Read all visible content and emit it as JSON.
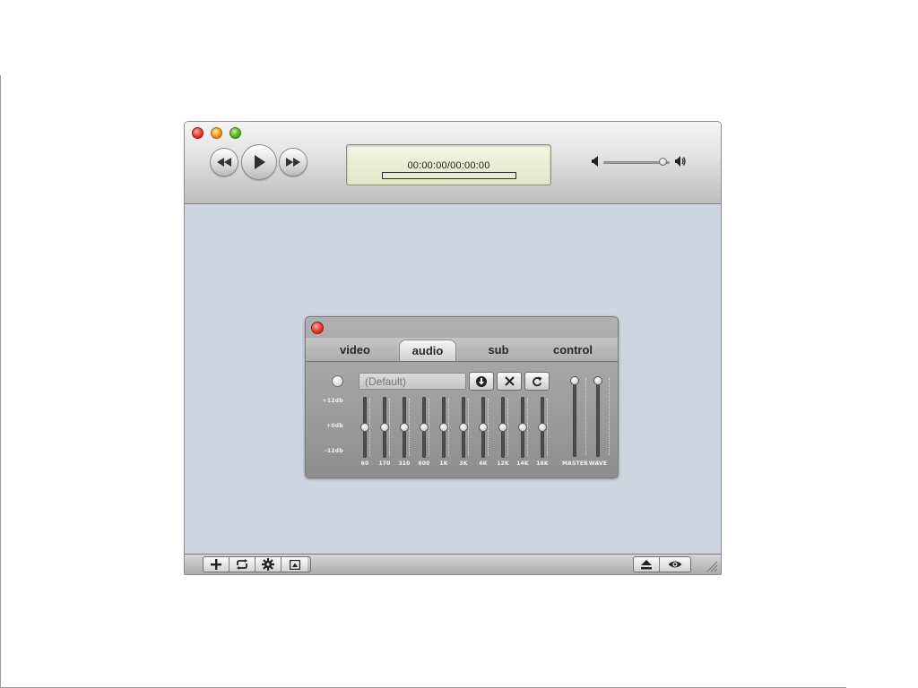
{
  "player": {
    "time_display": "00:00:00/00:00:00",
    "progress": 0,
    "volume": 0.95
  },
  "icons": {
    "window": [
      "close-icon",
      "minimize-icon",
      "zoom-icon"
    ],
    "transport": [
      "rewind-icon",
      "play-icon",
      "fast-forward-icon"
    ],
    "volume": [
      "speaker-low-icon",
      "speaker-high-icon"
    ],
    "bottom_left": [
      "add-icon",
      "repeat-icon",
      "gear-icon",
      "display-icon"
    ],
    "bottom_right": [
      "eject-icon",
      "eye-icon"
    ]
  },
  "colors": {
    "content_background": "#cfd5e0",
    "lcd_background": "#e8ebd0",
    "close_red": "#e84a3c",
    "minimize_yellow": "#f3a72a",
    "zoom_green": "#5fbd32"
  },
  "equalizer": {
    "tabs": [
      "video",
      "audio",
      "sub",
      "control"
    ],
    "active_tab": "audio",
    "preset_placeholder": "(Default)",
    "preset_value": "",
    "db_labels": [
      "+12db",
      "+0db",
      "-12db"
    ],
    "bands": [
      {
        "label": "60",
        "gain_db": 0
      },
      {
        "label": "170",
        "gain_db": 0
      },
      {
        "label": "310",
        "gain_db": 0
      },
      {
        "label": "600",
        "gain_db": 0
      },
      {
        "label": "1K",
        "gain_db": 0
      },
      {
        "label": "3K",
        "gain_db": 0
      },
      {
        "label": "6K",
        "gain_db": 0
      },
      {
        "label": "12K",
        "gain_db": 0
      },
      {
        "label": "14K",
        "gain_db": 0
      },
      {
        "label": "16K",
        "gain_db": 0
      }
    ],
    "master": {
      "label": "MASTER",
      "level": 1
    },
    "wave": {
      "label": "WAVE",
      "level": 1
    }
  }
}
